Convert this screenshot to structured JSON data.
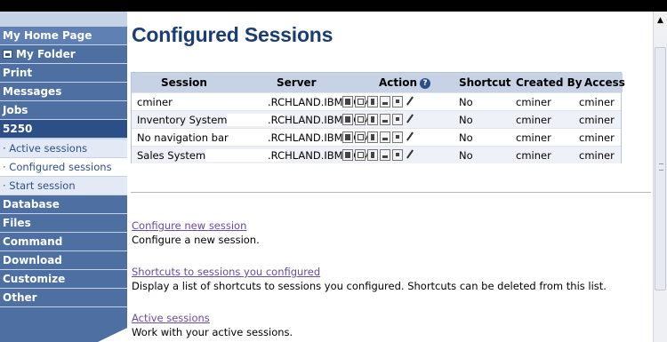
{
  "sidebar": {
    "home": "My Home Page",
    "folder": "My Folder",
    "items": [
      {
        "label": "Print",
        "kind": "dark"
      },
      {
        "label": "Messages",
        "kind": "dark"
      },
      {
        "label": "Jobs",
        "kind": "dark"
      },
      {
        "label": "5250",
        "kind": "main"
      },
      {
        "label": "· Active sessions",
        "kind": "sub"
      },
      {
        "label": "· Configured sessions",
        "kind": "active"
      },
      {
        "label": "· Start session",
        "kind": "sub"
      },
      {
        "label": "Database",
        "kind": "dark"
      },
      {
        "label": "Files",
        "kind": "dark"
      },
      {
        "label": "Command",
        "kind": "dark"
      },
      {
        "label": "Download",
        "kind": "dark"
      },
      {
        "label": "Customize",
        "kind": "dark"
      },
      {
        "label": "Other",
        "kind": "dark"
      }
    ]
  },
  "page_title": "Configured Sessions",
  "table": {
    "headers": [
      "Session",
      "Server",
      "Action",
      "Shortcut",
      "Created By",
      "Access"
    ],
    "rows": [
      {
        "session": "cminer",
        "server": ".RCHLAND.IBM.COM",
        "shortcut": "No",
        "created_by": "cminer",
        "access": "cminer"
      },
      {
        "session": "Inventory System",
        "server": ".RCHLAND.IBM.COM",
        "shortcut": "No",
        "created_by": "cminer",
        "access": "cminer"
      },
      {
        "session": "No navigation bar",
        "server": ".RCHLAND.IBM.COM",
        "shortcut": "No",
        "created_by": "cminer",
        "access": "cminer"
      },
      {
        "session": "Sales System",
        "server": ".RCHLAND.IBM.COM",
        "shortcut": "No",
        "created_by": "cminer",
        "access": "cminer"
      }
    ]
  },
  "links": [
    {
      "label": "Configure new session",
      "desc": "Configure a new session."
    },
    {
      "label": "Shortcuts to sessions you configured",
      "desc": "Display a list of shortcuts to sessions you configured. Shortcuts can be deleted from this list."
    },
    {
      "label": "Active sessions",
      "desc": "Work with your active sessions."
    }
  ],
  "colors": {
    "accent": "#1a3d74",
    "nav_dark": "#4e6fa2",
    "link": "#6a4b9e"
  }
}
